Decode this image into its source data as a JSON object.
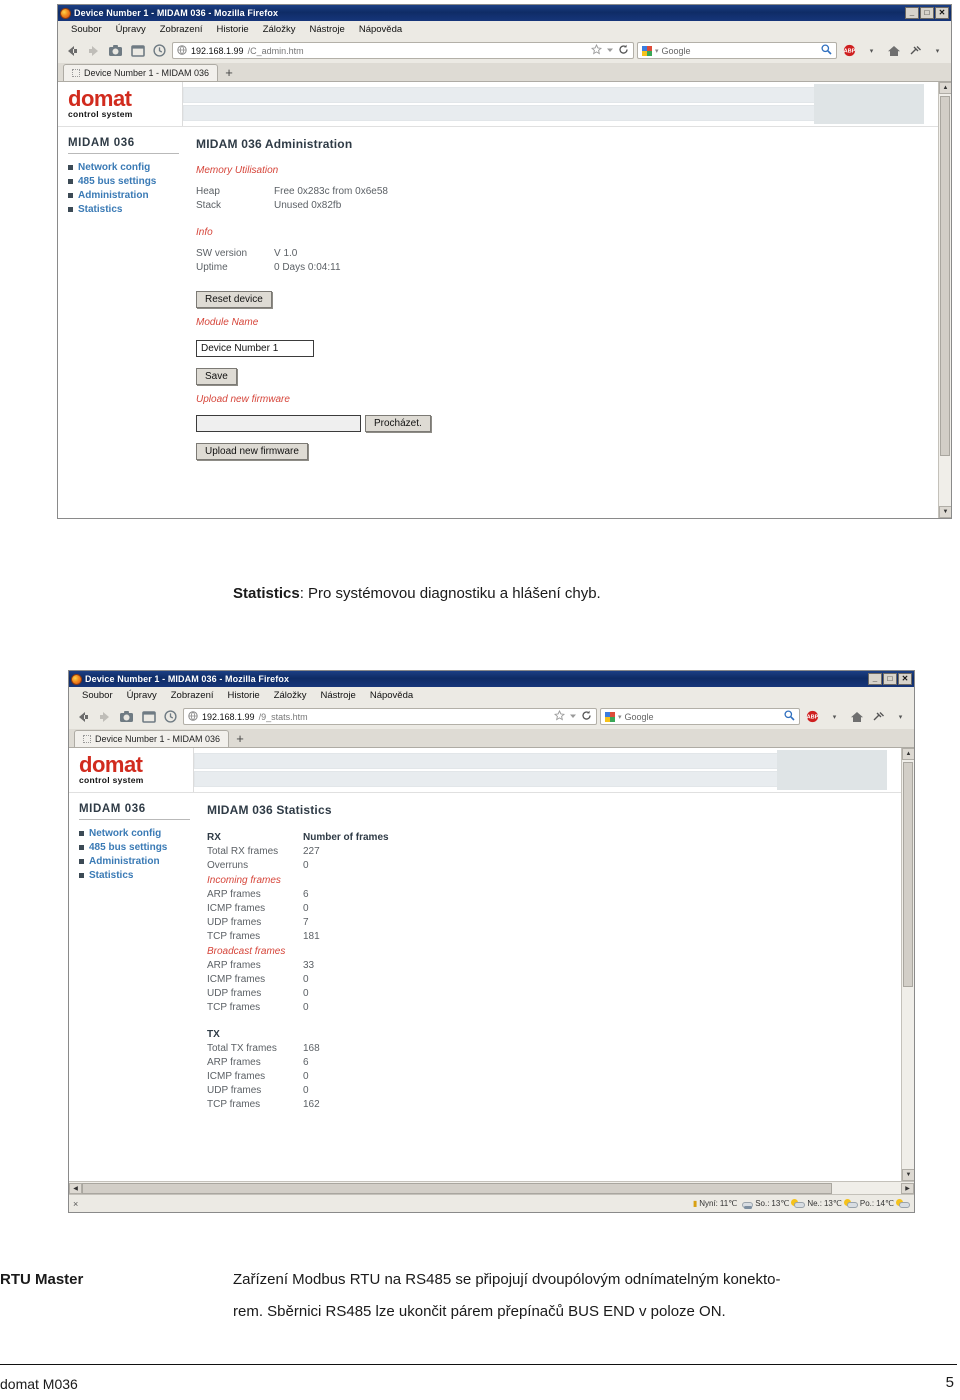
{
  "browser": {
    "window_buttons": {
      "minimize": "_",
      "maximize": "□",
      "close": "✕"
    },
    "menu": [
      "Soubor",
      "Úpravy",
      "Zobrazení",
      "Historie",
      "Záložky",
      "Nástroje",
      "Nápověda"
    ],
    "search_engine": "Google",
    "new_tab_label": "+"
  },
  "window1": {
    "title": "Device Number 1 - MIDAM 036 - Mozilla Firefox",
    "url_host": "192.168.1.99",
    "url_path": "/C_admin.htm",
    "tab_label": "Device Number 1 - MIDAM 036"
  },
  "window2": {
    "title": "Device Number 1 - MIDAM 036 - Mozilla Firefox",
    "url_host": "192.168.1.99",
    "url_path": "/9_stats.htm",
    "tab_label": "Device Number 1 - MIDAM 036",
    "statusbar": {
      "close_label": "×",
      "weather": [
        {
          "label": "Nyní:",
          "temp": "11℃",
          "icon": "rain-cloud-icon"
        },
        {
          "label": "So.:",
          "temp": "13℃",
          "icon": "sun-cloud-icon"
        },
        {
          "label": "Ne.:",
          "temp": "13℃",
          "icon": "sun-cloud-icon"
        },
        {
          "label": "Po.:",
          "temp": "14℃",
          "icon": "sun-cloud-icon"
        }
      ]
    }
  },
  "domat": {
    "logo_main": "domat",
    "logo_sub": "control system",
    "device_name": "MIDAM 036",
    "nav": [
      {
        "label": "Network config"
      },
      {
        "label": "485 bus settings"
      },
      {
        "label": "Administration"
      },
      {
        "label": "Statistics"
      }
    ]
  },
  "admin_page": {
    "title": "MIDAM 036 Administration",
    "memory_heading": "Memory Utilisation",
    "memory": [
      {
        "key": "Heap",
        "value": "Free 0x283c from 0x6e58"
      },
      {
        "key": "Stack",
        "value": "Unused 0x82fb"
      }
    ],
    "info_heading": "Info",
    "info": [
      {
        "key": "SW version",
        "value": "V 1.0"
      },
      {
        "key": "Uptime",
        "value": "0 Days 0:04:11"
      }
    ],
    "reset_button": "Reset device",
    "module_name_heading": "Module Name",
    "module_name_value": "Device Number 1",
    "save_button": "Save",
    "upload_heading": "Upload new firmware",
    "file_input_value": "",
    "browse_button": "Procházet.",
    "upload_button": "Upload new firmware"
  },
  "stats_page": {
    "title": "MIDAM 036 Statistics",
    "col_left": "RX",
    "col_right": "Number of frames",
    "rx_rows": [
      {
        "key": "Total RX frames",
        "value": "227"
      },
      {
        "key": "Overruns",
        "value": "0"
      }
    ],
    "incoming_heading": "Incoming frames",
    "incoming_rows": [
      {
        "key": "ARP frames",
        "value": "6"
      },
      {
        "key": "ICMP frames",
        "value": "0"
      },
      {
        "key": "UDP frames",
        "value": "7"
      },
      {
        "key": "TCP frames",
        "value": "181"
      }
    ],
    "broadcast_heading": "Broadcast frames",
    "broadcast_rows": [
      {
        "key": "ARP frames",
        "value": "33"
      },
      {
        "key": "ICMP frames",
        "value": "0"
      },
      {
        "key": "UDP frames",
        "value": "0"
      },
      {
        "key": "TCP frames",
        "value": "0"
      }
    ],
    "tx_heading": "TX",
    "tx_rows": [
      {
        "key": "Total TX frames",
        "value": "168"
      },
      {
        "key": "ARP frames",
        "value": "6"
      },
      {
        "key": "ICMP frames",
        "value": "0"
      },
      {
        "key": "UDP frames",
        "value": "0"
      },
      {
        "key": "TCP frames",
        "value": "162"
      }
    ]
  },
  "document": {
    "caption_bold": "Statistics",
    "caption_rest": ": Pro systémovou diagnostiku a hlášení chyb.",
    "bottom_term": "RTU Master",
    "bottom_line1": "Zařízení Modbus RTU na RS485 se připojují dvoupólovým odnímatelným konekto-",
    "bottom_line2": "rem. Sběrnici RS485 lze ukončit párem přepínačů BUS END v poloze ON.",
    "footer_left": "domat M036",
    "footer_right": "5"
  }
}
